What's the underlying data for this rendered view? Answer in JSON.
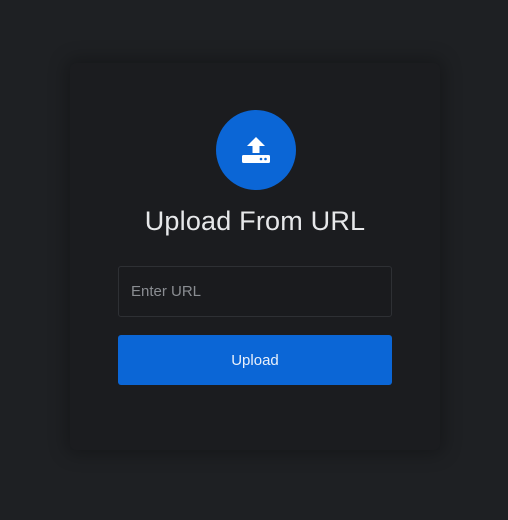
{
  "upload_panel": {
    "icon": "upload-to-drive-icon",
    "title": "Upload From URL",
    "url_input": {
      "value": "",
      "placeholder": "Enter URL"
    },
    "upload_button_label": "Upload"
  },
  "colors": {
    "background": "#1e2023",
    "card": "#1b1c1f",
    "accent": "#0b66d6",
    "title_text": "#e7e8ea",
    "placeholder_text": "#8a8d92"
  }
}
